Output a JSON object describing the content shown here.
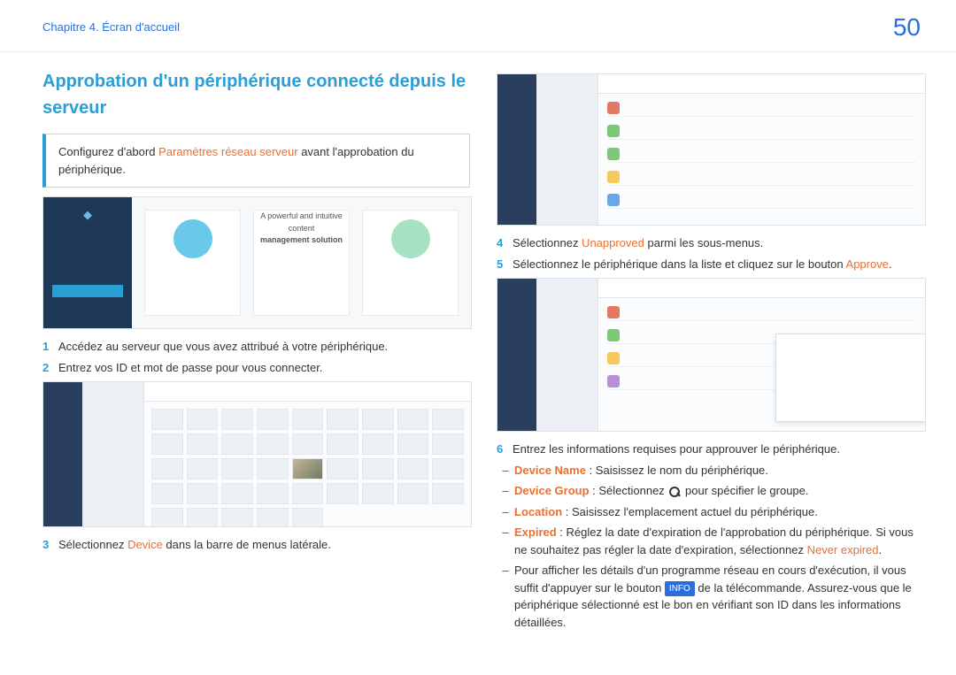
{
  "header": {
    "chapter": "Chapitre 4. Écran d'accueil",
    "page": "50"
  },
  "title": "Approbation d'un périphérique connecté depuis le serveur",
  "note": {
    "before": "Configurez d'abord ",
    "hl": "Paramètres réseau serveur",
    "after": " avant l'approbation du périphérique."
  },
  "login_caption": {
    "l1": "A powerful and intuitive content",
    "l2": "management solution"
  },
  "steps_left": {
    "s1": {
      "num": "1",
      "txt": "Accédez au serveur que vous avez attribué à votre périphérique."
    },
    "s2": {
      "num": "2",
      "txt": "Entrez vos ID et mot de passe pour vous connecter."
    },
    "s3": {
      "num": "3",
      "before": "Sélectionnez ",
      "hl": "Device",
      "after": " dans la barre de menus latérale."
    }
  },
  "steps_right": {
    "s4": {
      "num": "4",
      "before": "Sélectionnez ",
      "hl": "Unapproved",
      "after": " parmi les sous-menus."
    },
    "s5": {
      "num": "5",
      "before": "Sélectionnez le périphérique dans la liste et cliquez sur le bouton ",
      "hl": "Approve",
      "after": "."
    },
    "s6": {
      "num": "6",
      "txt": "Entrez les informations requises pour approuver le périphérique."
    }
  },
  "sub": {
    "b1": {
      "label": "Device Name",
      "txt": " : Saisissez le nom du périphérique."
    },
    "b2": {
      "label": "Device Group",
      "before": " : Sélectionnez ",
      "after": " pour spécifier le groupe."
    },
    "b3": {
      "label": "Location",
      "txt": " : Saisissez l'emplacement actuel du périphérique."
    },
    "b4": {
      "label": "Expired",
      "before": " : Réglez la date d'expiration de l'approbation du périphérique. Si vous ne souhaitez pas régler la date d'expiration, sélectionnez ",
      "hl": "Never expired",
      "after": "."
    },
    "b5": {
      "before": "Pour afficher les détails d'un programme réseau en cours d'exécution, il vous suffit d'appuyer sur le bouton ",
      "badge": "INFO",
      "after": " de la télécommande. Assurez-vous que le périphérique sélectionné est le bon en vérifiant son ID dans les informations détaillées."
    }
  }
}
